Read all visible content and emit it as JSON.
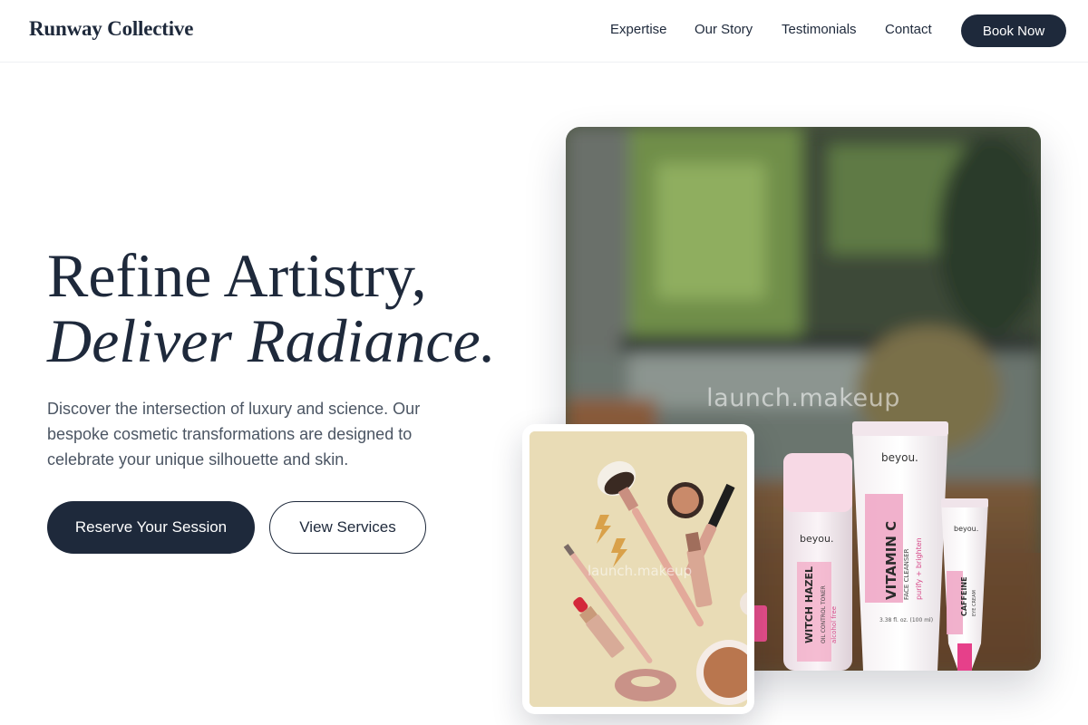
{
  "header": {
    "brand": "Runway Collective",
    "nav": [
      "Expertise",
      "Our Story",
      "Testimonials",
      "Contact"
    ],
    "cta": "Book Now"
  },
  "hero": {
    "headline_line1": "Refine Artistry,",
    "headline_line2": "Deliver Radiance.",
    "subcopy": "Discover the intersection of luxury and science. Our bespoke cosmetic transformations are designed to celebrate your unique silhouette and skin.",
    "primary_button": "Reserve Your Session",
    "secondary_button": "View Services"
  },
  "photos": {
    "main_watermark": "launch.makeup",
    "card_watermark": "launch.makeup",
    "main_brand_label": "beyou.",
    "product_labels": [
      "WITCH HAZEL",
      "VITAMIN C",
      "CAFFEINE"
    ]
  },
  "colors": {
    "primary": "#1e293b",
    "text_muted": "#4b5563",
    "card_background": "#e8dcb8",
    "product_pink": "#f0a9c7"
  }
}
